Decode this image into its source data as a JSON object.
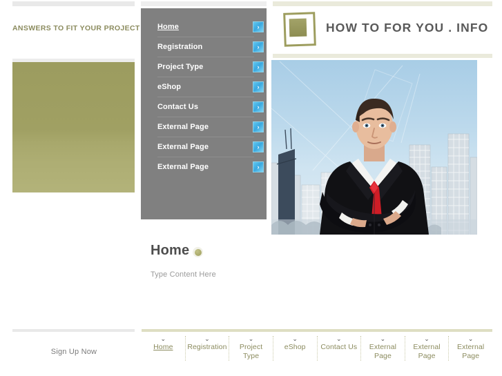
{
  "colors": {
    "olive": "#9d9d5e",
    "olive_text": "#8b8b5e",
    "nav_panel_gray": "#808080",
    "arrow_blue": "#3aa9e0",
    "title_gray": "#595959",
    "khaki_bar": "#dedec2"
  },
  "left_column": {
    "tagline": "ANSWERS TO FIT YOUR PROJECT"
  },
  "nav": {
    "items": [
      {
        "label": "Home",
        "active": true,
        "arrow": "›"
      },
      {
        "label": "Registration",
        "active": false,
        "arrow": "›"
      },
      {
        "label": "Project Type",
        "active": false,
        "arrow": "›"
      },
      {
        "label": "eShop",
        "active": false,
        "arrow": "›"
      },
      {
        "label": "Contact Us",
        "active": false,
        "arrow": "›"
      },
      {
        "label": "External Page",
        "active": false,
        "arrow": "›"
      },
      {
        "label": "External Page",
        "active": false,
        "arrow": "›"
      },
      {
        "label": "External Page",
        "active": false,
        "arrow": "›"
      }
    ]
  },
  "header": {
    "logo_icon": "square-logo-icon",
    "title": "HOW TO FOR YOU . INFO"
  },
  "hero": {
    "alt": "businessman-photo",
    "description": "Businessman in black suit with red tie, arms crossed, in front of a city skyline"
  },
  "content": {
    "page_title": "Home",
    "badge_icon": "olive-dot-icon",
    "placeholder": "Type Content Here"
  },
  "footer": {
    "signup_label": "Sign Up Now",
    "items": [
      {
        "label": "Home",
        "active": true,
        "chevron": "⌄"
      },
      {
        "label": "Registration",
        "active": false,
        "chevron": "⌄"
      },
      {
        "label": "Project Type",
        "active": false,
        "chevron": "⌄"
      },
      {
        "label": "eShop",
        "active": false,
        "chevron": "⌄"
      },
      {
        "label": "Contact Us",
        "active": false,
        "chevron": "⌄"
      },
      {
        "label": "External Page",
        "active": false,
        "chevron": "⌄"
      },
      {
        "label": "External Page",
        "active": false,
        "chevron": "⌄"
      },
      {
        "label": "External Page",
        "active": false,
        "chevron": "⌄"
      }
    ]
  }
}
